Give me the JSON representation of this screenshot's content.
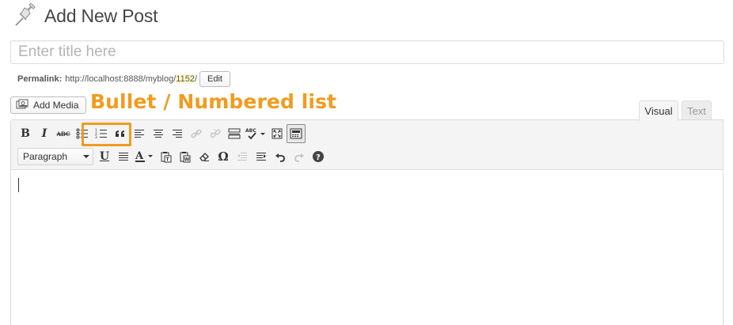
{
  "header": {
    "title": "Add New Post",
    "icon": "pushpin-icon"
  },
  "title_field": {
    "value": "",
    "placeholder": "Enter title here"
  },
  "permalink": {
    "label": "Permalink:",
    "base": "http://localhost:8888/myblog/",
    "slug": "1152",
    "suffix": "/",
    "edit_label": "Edit"
  },
  "media": {
    "add_media_label": "Add Media",
    "icon": "media-icon"
  },
  "annotation": {
    "text": "Bullet / Numbered list",
    "color": "#f29b1e"
  },
  "editor_tabs": [
    {
      "label": "Visual",
      "active": true
    },
    {
      "label": "Text",
      "active": false
    }
  ],
  "toolbar": {
    "row1": [
      "bold-icon",
      "italic-icon",
      "strikethrough-icon",
      "bullet-list-icon",
      "numbered-list-icon",
      "blockquote-icon",
      "align-left-icon",
      "align-center-icon",
      "align-right-icon",
      "link-icon",
      "unlink-icon",
      "read-more-icon",
      "spellcheck-icon",
      "fullscreen-icon",
      "kitchen-sink-icon"
    ],
    "row2": [
      "format-select",
      "underline-icon",
      "justify-icon",
      "text-color-icon",
      "paste-text-icon",
      "paste-word-icon",
      "clear-formatting-icon",
      "special-character-icon",
      "outdent-icon",
      "indent-icon",
      "undo-icon",
      "redo-icon",
      "help-icon"
    ],
    "bold_glyph": "B",
    "italic_glyph": "I",
    "strike_glyph": "ABC",
    "spell_glyph": "ABC",
    "underline_glyph": "U",
    "text_color_glyph": "A",
    "omega_glyph": "Ω",
    "help_glyph": "?",
    "format_value": "Paragraph"
  },
  "editor_content": {
    "value": ""
  }
}
